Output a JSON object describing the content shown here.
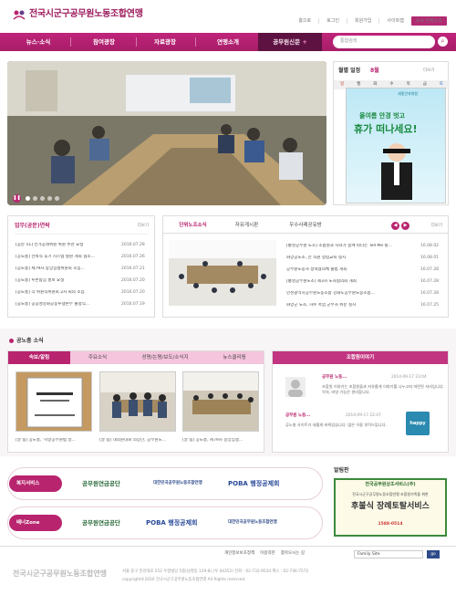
{
  "header": {
    "logo_text": "전국시군구공무원노동조합연맹",
    "top_links": [
      "홈으로",
      "로그인",
      "회원가입",
      "사이트맵"
    ],
    "subscribe_label": "소속 단위노조"
  },
  "gnb": {
    "items": [
      "뉴스·소식",
      "참여광장",
      "자료광장",
      "연맹소개"
    ],
    "news_label": "공무원신문",
    "search_placeholder": "통합검색"
  },
  "calendar": {
    "title": "월별 일정",
    "month": "8월",
    "more": "더보기",
    "days": [
      "일",
      "월",
      "화",
      "수",
      "목",
      "금",
      "토"
    ],
    "ad_title": "올여름 안경 벗고",
    "ad_main": "휴가 떠나세요!",
    "ad_brand": "새빛안과병원"
  },
  "union": {
    "title": "업무(공문)연락",
    "more": "더보기",
    "items": [
      {
        "text": "[공문 51] 전가공래위원 위원 추천 요청",
        "date": "2016.07.28"
      },
      {
        "text": "[공노총] 선박직 후기 시스템 평원 개최 협조...",
        "date": "2016.07.26"
      },
      {
        "text": "[공노총] 제79차 중앙집행위원회 소집...",
        "date": "2016.07.21"
      },
      {
        "text": "[공노총] 투론합심 홍보 요청",
        "date": "2016.07.20"
      },
      {
        "text": "[공노총] 각 위원직위원회 2차 회의 소집",
        "date": "2016.07.20"
      },
      {
        "text": "[공노총] 공공성강화공동투쟁본부 출정식...",
        "date": "2016.07.19"
      }
    ]
  },
  "unit_news": {
    "tabs": [
      "단위노조소식",
      "자유게시판",
      "우수사례공유방"
    ],
    "more": "더보기",
    "items": [
      {
        "text": "[통영공무원 노조] 조합원과 자녀가 함께 떠나는 Tell Me 탈...",
        "date": "16.08.02"
      },
      {
        "text": "화양공노조, 전 직원 청렴교육 실시",
        "date": "16.08.01"
      },
      {
        "text": "공무원노동자 정책협의체 출범 개최",
        "date": "16.07.28"
      },
      {
        "text": "[통영공무원노조] 제3차 노사협의회 개최",
        "date": "16.07.28"
      },
      {
        "text": "인천광역시공무원노동조합 강화도공무원노동조합...",
        "date": "16.07.28"
      },
      {
        "text": "화양군 노조, 하수 폭염 군부자 위문 실시",
        "date": "16.07.25"
      }
    ]
  },
  "news_section": {
    "title": "공노총 소식",
    "tabs": [
      "속보/알림",
      "주요소식",
      "성명/논평/보도/소식지",
      "뉴스클리핑"
    ],
    "captions": [
      "[알 림] 공노총, '지방공무원법 일...",
      "[알 림] 대의원대회 의장단, 공무원노...",
      "[알 림] 공노총, 제79차 중앙집행..."
    ]
  },
  "talk": {
    "title": "조합원이야기",
    "posts": [
      {
        "author": "공무원 노동...",
        "date": "2014-09-17 23:04",
        "body": "조합원 이야기는 조합원들과 자유롭게 이야기를 나누고자 마련된 자리입니다. 악의, 비방 기능은 관리합니다."
      },
      {
        "author": "공무원 노동...",
        "date": "2014-09-17 22:47",
        "body": "공노총 사이트가 새롭게 바뀌었습니다. 많은 이용 부탁드립니다."
      }
    ],
    "happy_label": "happy"
  },
  "banners": {
    "welfare_label": "복지서비스",
    "zone_label": "배너Zone",
    "row1": [
      "공무원연금공단",
      "대한민국공무원노동조합연맹",
      "POBA 행정공제회"
    ],
    "row2": [
      "공무원연금공단",
      "POBA 행정공제회",
      "대한민국공무원노동조합연맹"
    ]
  },
  "notice": {
    "title": "알림판",
    "head": "전국공무원상조서비스(주)",
    "sub": "전국시군구공무원노동조합연맹 조합원가족을 위한",
    "main": "후불식 장례토탈서비스",
    "phone": "1588-0514"
  },
  "footer": {
    "links": [
      "개인정보보호정책",
      "이용약관",
      "찾아오시는 길"
    ],
    "family_site": "Family Site",
    "go": "go",
    "logo_text": "전국시군구공무원노동조합연맹",
    "address": "서울 중구 한강대로 252 우정빌딩 5층(남영동 129-8) (우 04352) 전화 : 02-732-9534 팩스 : 02-736-7572",
    "copyright": "copyright©2016 전국시군구공무원노동조합연맹 All Rights reserved."
  },
  "colors": {
    "brand": "#b8246e",
    "brand_dark": "#5d1241",
    "accent_pink": "#f5c4dd"
  }
}
